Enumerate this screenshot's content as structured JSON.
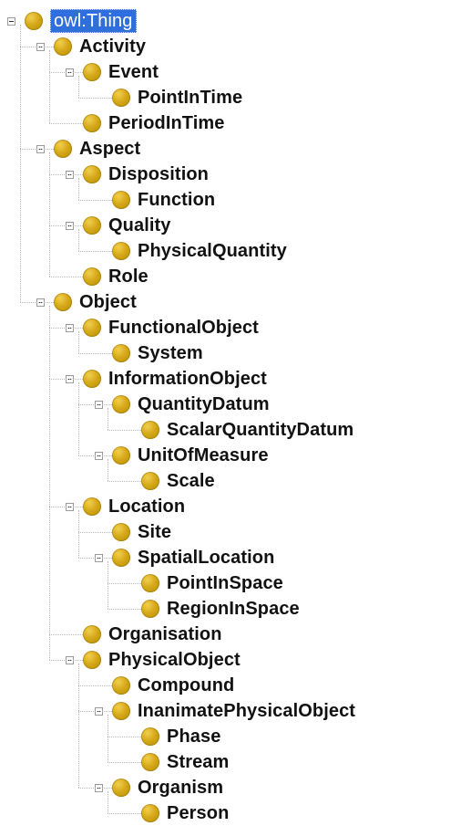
{
  "tree": {
    "root": {
      "label": "owl:Thing",
      "children": [
        {
          "label": "Activity",
          "children": [
            {
              "label": "Event",
              "children": [
                {
                  "label": "PointInTime"
                }
              ]
            },
            {
              "label": "PeriodInTime"
            }
          ]
        },
        {
          "label": "Aspect",
          "children": [
            {
              "label": "Disposition",
              "children": [
                {
                  "label": "Function"
                }
              ]
            },
            {
              "label": "Quality",
              "children": [
                {
                  "label": "PhysicalQuantity"
                }
              ]
            },
            {
              "label": "Role"
            }
          ]
        },
        {
          "label": "Object",
          "children": [
            {
              "label": "FunctionalObject",
              "children": [
                {
                  "label": "System"
                }
              ]
            },
            {
              "label": "InformationObject",
              "children": [
                {
                  "label": "QuantityDatum",
                  "children": [
                    {
                      "label": "ScalarQuantityDatum"
                    }
                  ]
                },
                {
                  "label": "UnitOfMeasure",
                  "children": [
                    {
                      "label": "Scale"
                    }
                  ]
                }
              ]
            },
            {
              "label": "Location",
              "children": [
                {
                  "label": "Site"
                },
                {
                  "label": "SpatialLocation",
                  "children": [
                    {
                      "label": "PointInSpace"
                    },
                    {
                      "label": "RegionInSpace"
                    }
                  ]
                }
              ]
            },
            {
              "label": "Organisation"
            },
            {
              "label": "PhysicalObject",
              "children": [
                {
                  "label": "Compound"
                },
                {
                  "label": "InanimatePhysicalObject",
                  "children": [
                    {
                      "label": "Phase"
                    },
                    {
                      "label": "Stream"
                    }
                  ]
                },
                {
                  "label": "Organism",
                  "children": [
                    {
                      "label": "Person"
                    }
                  ]
                }
              ]
            }
          ]
        }
      ]
    }
  },
  "icons": {
    "toggle": "collapse-icon",
    "bullet": "class-icon"
  },
  "colors": {
    "bullet": "#d6a91b",
    "selected_bg": "#2f6fda",
    "selected_text": "#ffffff",
    "text": "#111111",
    "connector": "#b8b8b8"
  }
}
